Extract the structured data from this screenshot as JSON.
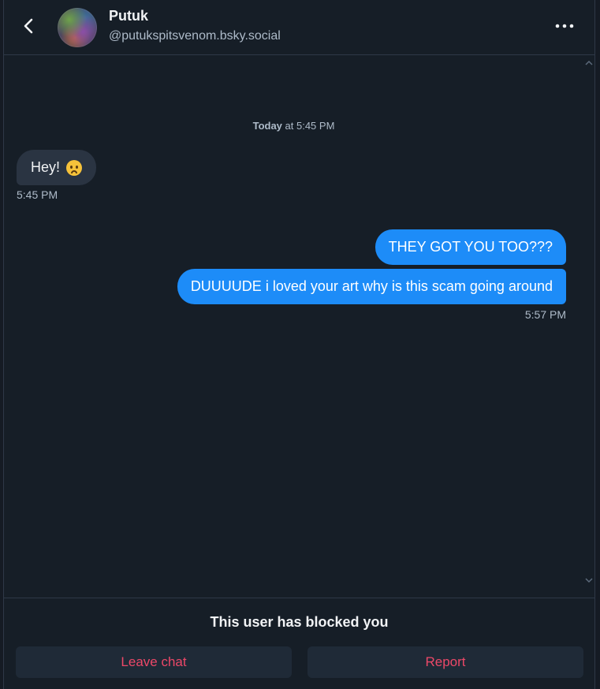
{
  "header": {
    "name": "Putuk",
    "handle": "@putukspitsvenom.bsky.social"
  },
  "conversation": {
    "date_separator": {
      "bold": "Today",
      "rest": " at 5:45 PM"
    },
    "incoming": {
      "text": "Hey!",
      "emoji_icon": "frowning-face-emoji",
      "time": "5:45 PM"
    },
    "outgoing": [
      {
        "text": "THEY GOT YOU TOO???"
      },
      {
        "text": "DUUUUDE i loved your art why is this scam going around"
      }
    ],
    "outgoing_time": "5:57 PM"
  },
  "footer": {
    "blocked_notice": "This user has blocked you",
    "leave_label": "Leave chat",
    "report_label": "Report"
  },
  "colors": {
    "background": "#161e27",
    "incoming_bubble": "#2a3442",
    "outgoing_bubble": "#1d8cf8",
    "danger_text": "#ec4868",
    "secondary_text": "#aebbc9"
  }
}
